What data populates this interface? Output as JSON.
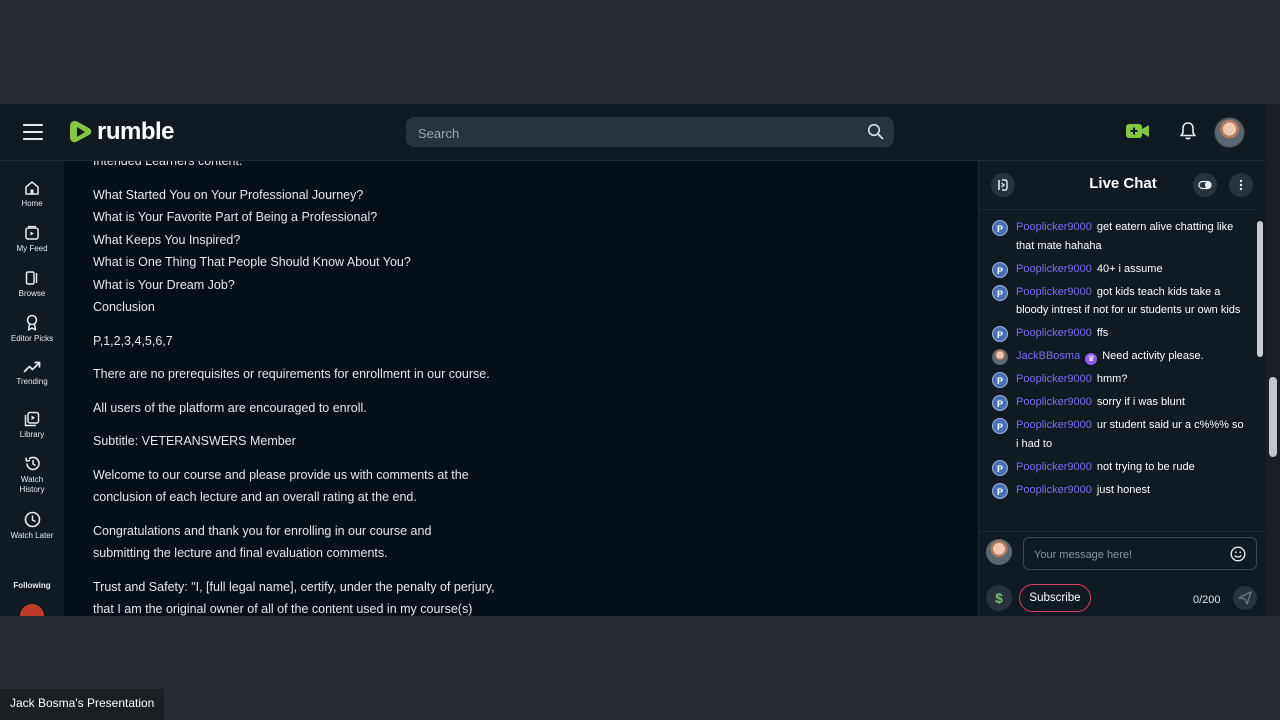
{
  "search": {
    "placeholder": "Search"
  },
  "logo": {
    "text": "rumble"
  },
  "nav": {
    "items": [
      {
        "label": "Home"
      },
      {
        "label": "My Feed"
      },
      {
        "label": "Browse"
      },
      {
        "label": "Editor Picks"
      },
      {
        "label": "Trending"
      },
      {
        "label": "Library"
      },
      {
        "label": "Watch History"
      },
      {
        "label": "Watch Later"
      }
    ],
    "following_label": "Following"
  },
  "content": {
    "cut_line": "Intended Learners content:",
    "questions": [
      "What Started You on Your Professional Journey?",
      "What is Your Favorite Part of Being a Professional?",
      "What Keeps You Inspired?",
      "What is One Thing That People Should Know About You?",
      "What is Your Dream Job?",
      "Conclusion"
    ],
    "sequence": "P,1,2,3,4,5,6,7",
    "prereq": "There are no prerequisites or requirements for enrollment in our course.",
    "encourage": "All users of the platform are encouraged to enroll.",
    "subtitle": "Subtitle: VETERANSWERS Member",
    "welcome_1": "Welcome to our course and please provide us with comments at the",
    "welcome_2": "conclusion of each lecture and an overall rating at the end.",
    "congrats_1": "Congratulations and thank you for enrolling in our course and",
    "congrats_2": "submitting the lecture and final evaluation comments.",
    "trust_1": "Trust and Safety: \"I, [full legal name], certify, under the penalty of perjury,",
    "trust_2": "that I am the original owner of all of the content used in my course(s)"
  },
  "chat": {
    "title": "Live Chat",
    "messages": [
      {
        "user": "Pooplicker9000",
        "text": "get eatern alive chatting like that mate hahaha"
      },
      {
        "user": "Pooplicker9000",
        "text": "40+ i assume"
      },
      {
        "user": "Pooplicker9000",
        "text": "got kids teach kids take a bloody intrest if not for ur students ur own kids"
      },
      {
        "user": "Pooplicker9000",
        "text": "ffs"
      },
      {
        "user": "JackBBosma",
        "text": "Need activity please."
      },
      {
        "user": "Pooplicker9000",
        "text": "hmm?"
      },
      {
        "user": "Pooplicker9000",
        "text": "sorry if i was blunt"
      },
      {
        "user": "Pooplicker9000",
        "text": "ur student said ur a c%%%  so i had to"
      },
      {
        "user": "Pooplicker9000",
        "text": "not trying to be rude"
      },
      {
        "user": "Pooplicker9000",
        "text": "just honest"
      }
    ],
    "avatar_letter": "P",
    "input_placeholder": "Your message here!",
    "subscribe_label": "Subscribe",
    "char_count": "0/200",
    "dollar": "$"
  },
  "caption": "Jack Bosma's Presentation",
  "colors": {
    "brand": "#85c742",
    "username": "#7d6cf0",
    "subscribe_border": "#e0415b"
  }
}
